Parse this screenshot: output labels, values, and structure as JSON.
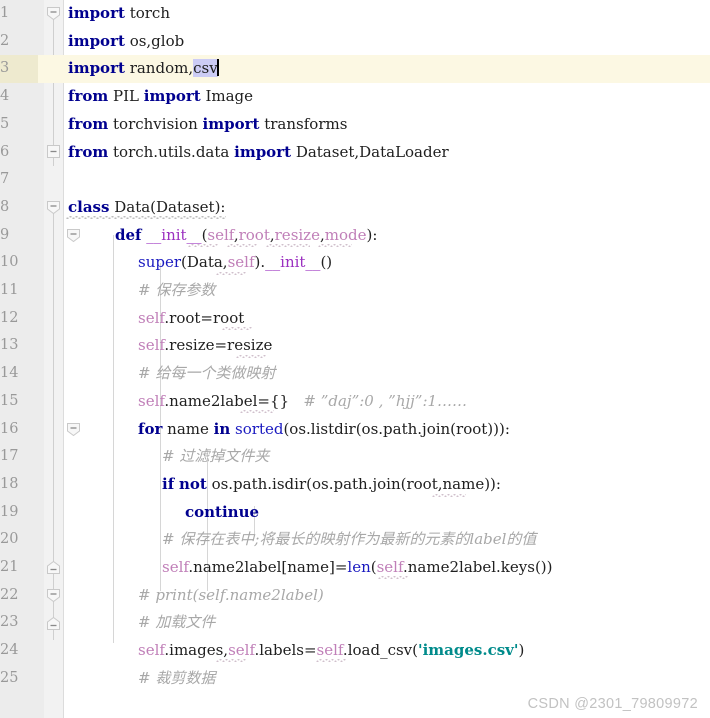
{
  "editor": {
    "language": "Python",
    "current_line": 3,
    "colors": {
      "background": "#ffffff",
      "gutter_background": "#ececec",
      "fold_strip_background": "#f2f2f2",
      "current_line_highlight": "#fcf8e3",
      "selection": "#ccccf5",
      "keyword": "#00008f",
      "builtin": "#1a1ac0",
      "self_param": "#c07fb8",
      "function_name": "#9b30c0",
      "string": "#008b8b",
      "comment": "#a8a8a8",
      "text": "#202020",
      "line_number": "#999999",
      "indent_guide": "#d6d6d6",
      "watermark": "#c2c2c2"
    },
    "line_numbers": [
      "1",
      "2",
      "3",
      "4",
      "5",
      "6",
      "7",
      "8",
      "9",
      "10",
      "11",
      "12",
      "13",
      "14",
      "15",
      "16",
      "17",
      "18",
      "19",
      "20",
      "21",
      "22",
      "23",
      "24",
      "25"
    ],
    "lines": [
      {
        "n": "1",
        "text": "import torch"
      },
      {
        "n": "2",
        "text": "import os,glob"
      },
      {
        "n": "3",
        "text": "import random,csv"
      },
      {
        "n": "4",
        "text": "from PIL import Image"
      },
      {
        "n": "5",
        "text": "from torchvision import transforms"
      },
      {
        "n": "6",
        "text": "from torch.utils.data import Dataset,DataLoader"
      },
      {
        "n": "7",
        "text": ""
      },
      {
        "n": "8",
        "text": "class Data(Dataset):"
      },
      {
        "n": "9",
        "text": "    def __init__(self,root,resize,mode):"
      },
      {
        "n": "10",
        "text": "        super(Data,self).__init__()"
      },
      {
        "n": "11",
        "text": "        # 保存参数"
      },
      {
        "n": "12",
        "text": "        self.root=root"
      },
      {
        "n": "13",
        "text": "        self.resize=resize"
      },
      {
        "n": "14",
        "text": "        # 给每一个类做映射"
      },
      {
        "n": "15",
        "text": "        self.name2label={}   # \"daj\":0 , \"hjj\":1……"
      },
      {
        "n": "16",
        "text": "        for name in sorted(os.listdir(os.path.join(root))):"
      },
      {
        "n": "17",
        "text": "            # 过滤掉文件夹"
      },
      {
        "n": "18",
        "text": "            if not os.path.isdir(os.path.join(root,name)):"
      },
      {
        "n": "19",
        "text": "                continue"
      },
      {
        "n": "20",
        "text": "            # 保存在表中;将最长的映射作为最新的元素的label的值"
      },
      {
        "n": "21",
        "text": "            self.name2label[name]=len(self.name2label.keys())"
      },
      {
        "n": "22",
        "text": "        # print(self.name2label)"
      },
      {
        "n": "23",
        "text": "        # 加载文件"
      },
      {
        "n": "24",
        "text": "        self.images,self.labels=self.load_csv('images.csv')"
      },
      {
        "n": "25",
        "text": "        # 裁剪数据"
      }
    ],
    "selection": {
      "line": 3,
      "text": "csv"
    },
    "fold_markers": [
      {
        "line": 1,
        "state": "expanded",
        "shape": "region-start"
      },
      {
        "line": 6,
        "state": "expanded",
        "shape": "plain"
      },
      {
        "line": 8,
        "state": "expanded",
        "shape": "region-start"
      },
      {
        "line": 9,
        "state": "expanded",
        "shape": "region-start"
      },
      {
        "line": 16,
        "state": "expanded",
        "shape": "region-start"
      },
      {
        "line": 21,
        "state": "expanded",
        "shape": "region-end"
      },
      {
        "line": 22,
        "state": "expanded",
        "shape": "region-start"
      },
      {
        "line": 23,
        "state": "expanded",
        "shape": "region-end"
      }
    ]
  },
  "watermark": {
    "text": "CSDN @2301_79809972"
  }
}
